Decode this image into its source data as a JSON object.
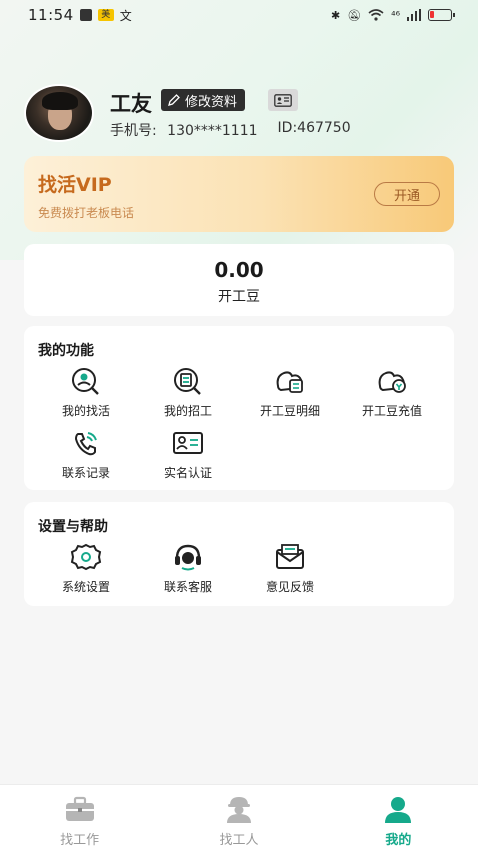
{
  "status_bar": {
    "time": "11:54",
    "badge_text": "美",
    "translate_glyph": "文",
    "network": "⁴⁶"
  },
  "profile": {
    "name": "工友",
    "edit_label": "修改资料",
    "phone_label": "手机号:",
    "phone_value": "130****1111",
    "id_text": "ID:467750"
  },
  "vip": {
    "title": "找活VIP",
    "subtitle": "免费拨打老板电话",
    "button": "开通",
    "colors": {
      "title": "#c66a1e",
      "bg_start": "#fdf0d8",
      "bg_end": "#f8c978"
    }
  },
  "beans": {
    "value": "0.00",
    "label": "开工豆"
  },
  "functions": {
    "title": "我的功能",
    "items": [
      {
        "label": "我的找活",
        "icon": "find-job-icon"
      },
      {
        "label": "我的招工",
        "icon": "recruit-icon"
      },
      {
        "label": "开工豆明细",
        "icon": "bean-detail-icon"
      },
      {
        "label": "开工豆充值",
        "icon": "bean-recharge-icon"
      },
      {
        "label": "联系记录",
        "icon": "call-record-icon"
      },
      {
        "label": "实名认证",
        "icon": "id-verify-icon"
      }
    ]
  },
  "settings": {
    "title": "设置与帮助",
    "items": [
      {
        "label": "系统设置",
        "icon": "gear-icon"
      },
      {
        "label": "联系客服",
        "icon": "headset-icon"
      },
      {
        "label": "意见反馈",
        "icon": "feedback-icon"
      }
    ]
  },
  "tabbar": {
    "items": [
      {
        "label": "找工作",
        "icon": "briefcase-icon",
        "active": false
      },
      {
        "label": "找工人",
        "icon": "worker-icon",
        "active": false
      },
      {
        "label": "我的",
        "icon": "user-icon",
        "active": true
      }
    ]
  },
  "colors": {
    "accent": "#16a98b",
    "page_bg": "#f6f6f6"
  }
}
